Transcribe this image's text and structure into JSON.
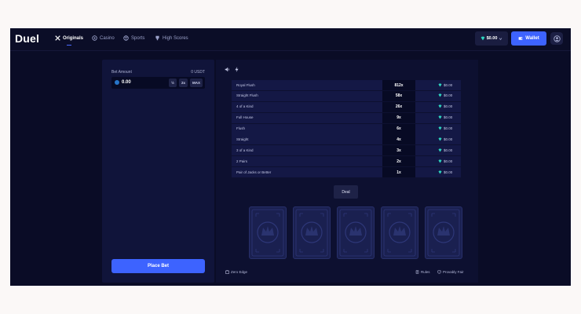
{
  "header": {
    "logo": "Duel",
    "nav": [
      {
        "label": "Originals",
        "icon": "cross-swords-icon",
        "active": true
      },
      {
        "label": "Casino",
        "icon": "casino-chip-icon",
        "active": false
      },
      {
        "label": "Sports",
        "icon": "ball-icon",
        "active": false
      },
      {
        "label": "High Scores",
        "icon": "trophy-icon",
        "active": false
      }
    ],
    "balance": "$0.00",
    "wallet_label": "Wallet"
  },
  "bet_panel": {
    "bet_amount_label": "Bet Amount",
    "currency_value": "0 USDT",
    "bet_value": "0.00",
    "half_label": "½",
    "double_label": "2x",
    "max_label": "MAX",
    "place_bet_label": "Place Bet"
  },
  "paytable": [
    {
      "hand": "Royal Flush",
      "multiplier": "812x",
      "payout": "$0.00"
    },
    {
      "hand": "Straight Flush",
      "multiplier": "58x",
      "payout": "$0.00"
    },
    {
      "hand": "4 of a Kind",
      "multiplier": "26x",
      "payout": "$0.00"
    },
    {
      "hand": "Full House",
      "multiplier": "9x",
      "payout": "$0.00"
    },
    {
      "hand": "Flush",
      "multiplier": "6x",
      "payout": "$0.00"
    },
    {
      "hand": "Straight",
      "multiplier": "4x",
      "payout": "$0.00"
    },
    {
      "hand": "3 of a Kind",
      "multiplier": "3x",
      "payout": "$0.00"
    },
    {
      "hand": "2 Pairs",
      "multiplier": "2x",
      "payout": "$0.00"
    },
    {
      "hand": "Pair of Jacks or Better",
      "multiplier": "1x",
      "payout": "$0.00"
    }
  ],
  "game": {
    "deal_label": "Deal",
    "card_count": 5,
    "zero_edge_label": "Zero Edge",
    "rules_label": "Rules",
    "provably_fair_label": "Provably Fair"
  },
  "colors": {
    "accent": "#3d63ff",
    "background": "#0a0c26",
    "gem": "#2dd4bf"
  }
}
